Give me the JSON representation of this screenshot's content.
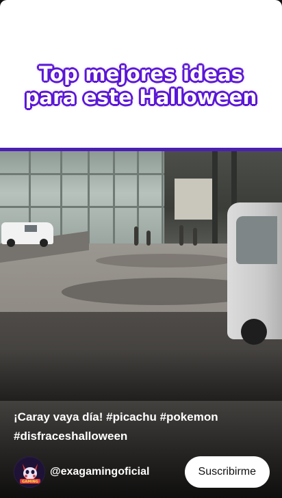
{
  "overlay_title": {
    "line1": "Top mejores ideas",
    "line2": "para este Halloween"
  },
  "caption": {
    "text": "¡Caray vaya día!",
    "hashtags": [
      "#picachu",
      "#pokemon",
      "#disfraceshalloween"
    ]
  },
  "channel": {
    "handle": "@exagamingoficial",
    "avatar_text": "GAMING"
  },
  "subscribe": {
    "label": "Suscribirme"
  },
  "colors": {
    "title_outline": "#5b16d6",
    "title_fill": "#ffffff",
    "divider": "#4b1fb3",
    "subscribe_bg": "#ffffff",
    "subscribe_text": "#0f0f0f"
  }
}
